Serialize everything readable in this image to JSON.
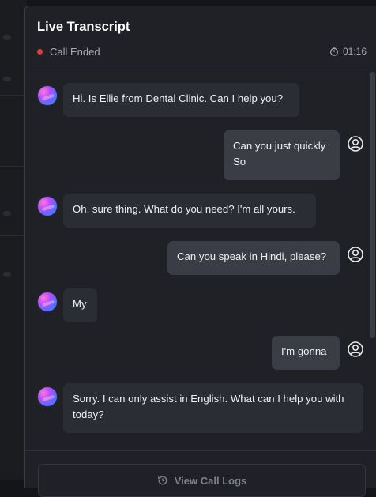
{
  "panel": {
    "title": "Live Transcript",
    "status": "Call Ended",
    "duration": "01:16",
    "colors": {
      "status_dot": "#e03a3a",
      "assistant_bubble": "#2a2d34",
      "user_bubble": "#3a3d46"
    }
  },
  "messages": [
    {
      "role": "assistant",
      "text": "Hi. Is Ellie from Dental Clinic. Can I help you?"
    },
    {
      "role": "user",
      "text": "Can you just quickly So"
    },
    {
      "role": "assistant",
      "text": "Oh, sure thing. What do you need? I'm all yours."
    },
    {
      "role": "user",
      "text": "Can you speak in Hindi, please?"
    },
    {
      "role": "assistant",
      "text": "My"
    },
    {
      "role": "user",
      "text": "I'm gonna"
    },
    {
      "role": "assistant",
      "text": "Sorry. I can only assist in English. What can I help you with today?"
    }
  ],
  "footer": {
    "view_logs_label": "View Call Logs"
  }
}
